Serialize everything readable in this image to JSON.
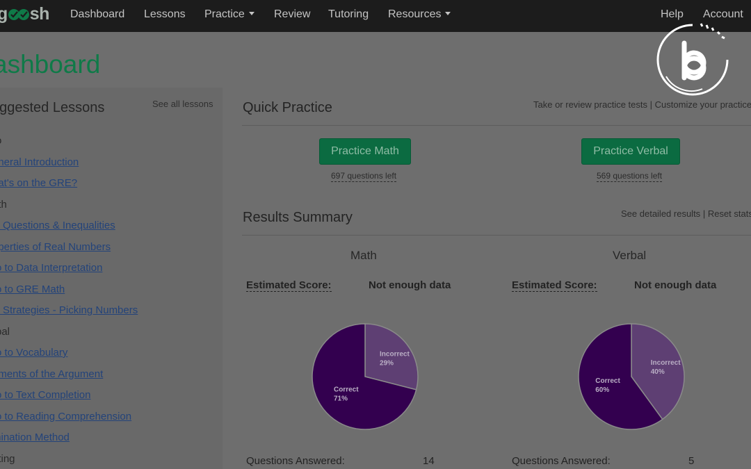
{
  "navbar": {
    "logo_prefix": "g",
    "logo_suffix": "sh",
    "items": [
      {
        "label": "Dashboard"
      },
      {
        "label": "Lessons"
      },
      {
        "label": "Practice"
      },
      {
        "label": "Review"
      },
      {
        "label": "Tutoring"
      },
      {
        "label": "Resources"
      }
    ],
    "help": "Help",
    "account": "Account"
  },
  "page_title": "ashboard",
  "sidebar": {
    "heading": "uggested Lessons",
    "see_all": "See all lessons",
    "rows": [
      {
        "text": "ro",
        "kind": "category"
      },
      {
        "text": "eneral Introduction",
        "kind": "link"
      },
      {
        "text": "hat's on the GRE?",
        "kind": "link"
      },
      {
        "text": "ath",
        "kind": "category"
      },
      {
        "text": "C Questions & Inequalities",
        "kind": "link"
      },
      {
        "text": "operties of Real Numbers",
        "kind": "link"
      },
      {
        "text": "ro to Data Interpretation",
        "kind": "link"
      },
      {
        "text": "ro to GRE Math",
        "kind": "link"
      },
      {
        "text": "C Strategies - Picking Numbers",
        "kind": "link"
      },
      {
        "text": "rbal",
        "kind": "category"
      },
      {
        "text": "ro to Vocabulary",
        "kind": "link"
      },
      {
        "text": "ements of the Argument",
        "kind": "link"
      },
      {
        "text": "ro to Text Completion",
        "kind": "link"
      },
      {
        "text": "ro to Reading Comprehension",
        "kind": "link"
      },
      {
        "text": "mination Method",
        "kind": "link"
      },
      {
        "text": "riting",
        "kind": "category"
      }
    ]
  },
  "quick_practice": {
    "title": "Quick Practice",
    "meta_left": "Take or review practice tests",
    "meta_sep": "|",
    "meta_right": "Customize your practice",
    "math_button": "Practice Math",
    "math_left": "697 questions left",
    "verbal_button": "Practice Verbal",
    "verbal_left": "569 questions left"
  },
  "results": {
    "title": "Results Summary",
    "meta_left": "See detailed results",
    "meta_sep": "|",
    "meta_right": "Reset stats",
    "math": {
      "title": "Math",
      "est_label": "Estimated Score:",
      "est_value": "Not enough data",
      "qa_label": "Questions Answered:",
      "qa_value": "14"
    },
    "verbal": {
      "title": "Verbal",
      "est_label": "Estimated Score:",
      "est_value": "Not enough data",
      "qa_label": "Questions Answered:",
      "qa_value": "5"
    }
  },
  "colors": {
    "correct": "#33004f",
    "incorrect": "#5e3f73",
    "brand_green": "#0f7a48"
  },
  "chart_data": [
    {
      "type": "pie",
      "title": "Math",
      "labels": [
        "Correct",
        "Incorrect"
      ],
      "values": [
        71,
        29
      ],
      "display": [
        "71%",
        "29%"
      ]
    },
    {
      "type": "pie",
      "title": "Verbal",
      "labels": [
        "Correct",
        "Incorrect"
      ],
      "values": [
        60,
        40
      ],
      "display": [
        "60%",
        "40%"
      ]
    }
  ]
}
